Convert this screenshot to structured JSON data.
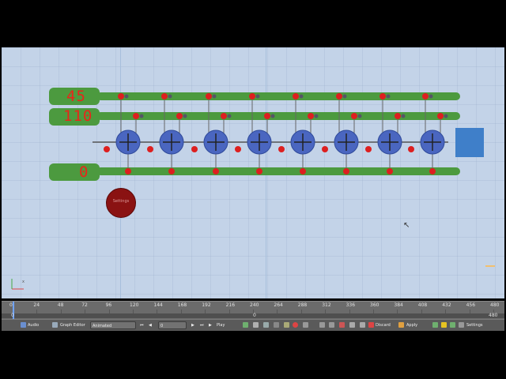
{
  "viewport": {
    "displays": [
      "45",
      "110",
      "0"
    ],
    "settings_button_label": "Settings",
    "colors": {
      "bar": "#4c9a3f",
      "motor": "#4a66c0",
      "bead": "#dd1f1f",
      "viewport_bg": "#c3d3e8",
      "cube": "#3f7fc9"
    }
  },
  "timeline": {
    "ticks": [
      "0",
      "24",
      "48",
      "72",
      "96",
      "120",
      "144",
      "168",
      "192",
      "216",
      "240",
      "264",
      "288",
      "312",
      "336",
      "360",
      "384",
      "408",
      "432",
      "456",
      "480"
    ],
    "current_frame": "0",
    "range_start": "0",
    "range_end": "480"
  },
  "header": {
    "audio_label": "Audio",
    "graph_editor_label": "Graph Editor",
    "mode_value": "Animated",
    "frame_value": "0",
    "play_label": "Play",
    "discard_label": "Discard",
    "apply_label": "Apply",
    "settings_label": "Settings"
  }
}
